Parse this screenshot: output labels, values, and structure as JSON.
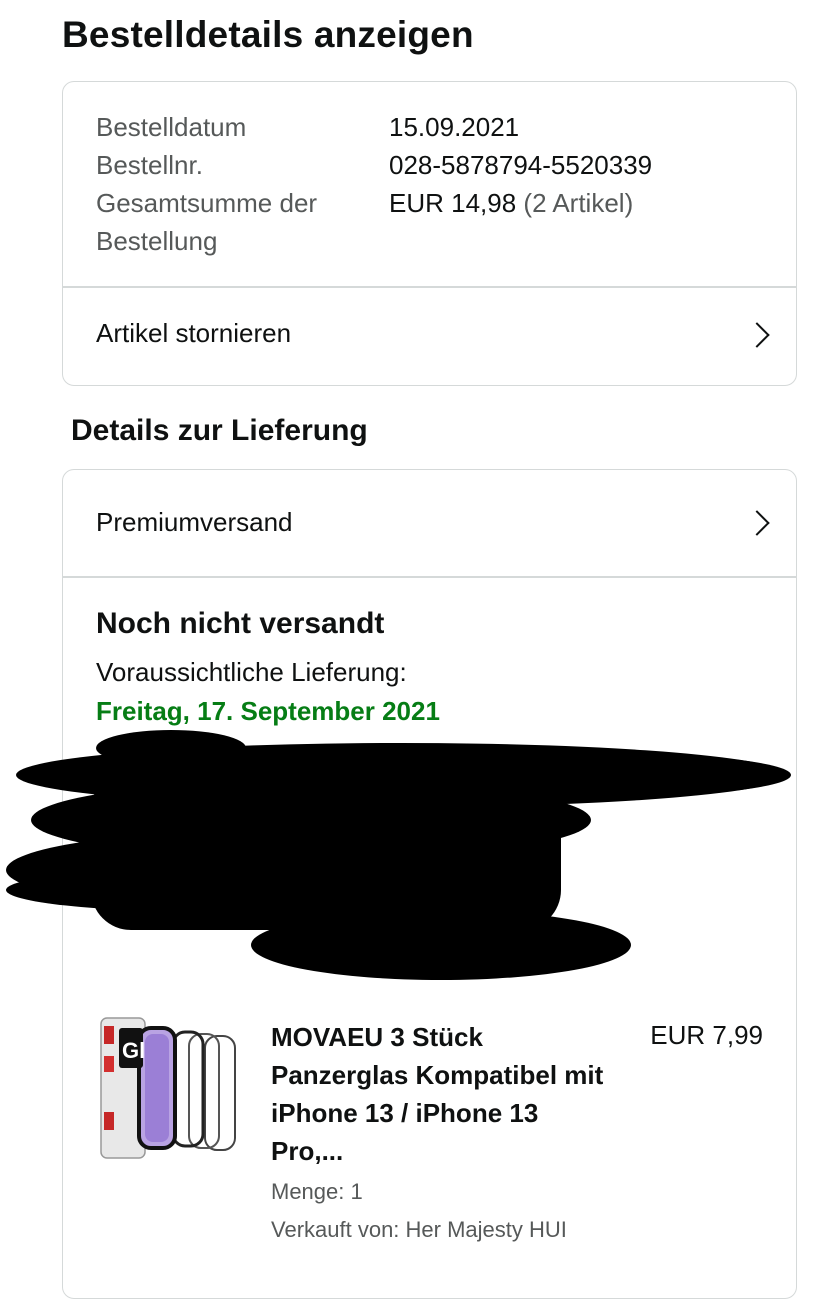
{
  "page": {
    "title": "Bestelldetails anzeigen"
  },
  "summary": {
    "order_date_label": "Bestelldatum",
    "order_date_value": "15.09.2021",
    "order_number_label": "Bestellnr.",
    "order_number_value": "028-5878794-5520339",
    "total_label_line1": "Gesamtsumme der",
    "total_label_line2": "Bestellung",
    "total_value": "EUR 14,98",
    "item_count": "(2 Artikel)",
    "cancel_label": "Artikel stornieren"
  },
  "delivery": {
    "section_title": "Details zur Lieferung",
    "shipping_method": "Premiumversand",
    "status": "Noch nicht versandt",
    "eta_label": "Voraussichtliche Lieferung:",
    "eta_date": "Freitag, 17. September 2021",
    "eta_color": "#067d15"
  },
  "product": {
    "title": "MOVAEU 3 Stück Panzerglas Kompatibel mit iPhone 13 / iPhone 13 Pro,...",
    "price": "EUR 7,99",
    "quantity": "Menge: 1",
    "seller": "Verkauft von: Her Majesty HUI"
  }
}
